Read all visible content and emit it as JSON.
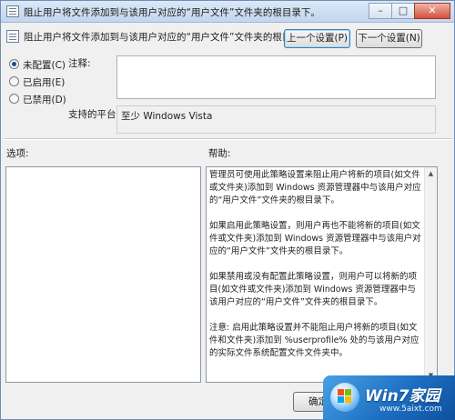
{
  "window": {
    "title": "阻止用户将文件添加到与该用户对应的“用户文件”文件夹的根目录下。"
  },
  "header": {
    "policy_title": "阻止用户将文件添加到与该用户对应的“用户文件”文件夹的根目录下。",
    "prev_button": "上一个设置(P)",
    "next_button": "下一个设置(N)"
  },
  "state": {
    "options": [
      {
        "label": "未配置(C)",
        "checked": true
      },
      {
        "label": "已启用(E)",
        "checked": false
      },
      {
        "label": "已禁用(D)",
        "checked": false
      }
    ]
  },
  "comment": {
    "label": "注释:",
    "value": ""
  },
  "platform": {
    "label": "支持的平台:",
    "value": "至少 Windows Vista"
  },
  "options_section": {
    "label": "选项:"
  },
  "help_section": {
    "label": "帮助:",
    "paragraphs": [
      "管理员可使用此策略设置来阻止用户将新的项目(如文件或文件夹)添加到 Windows 资源管理器中与该用户对应的“用户文件”文件夹的根目录下。",
      "如果启用此策略设置，则用户再也不能将新的项目(如文件或文件夹)添加到 Windows 资源管理器中与该用户对应的“用户文件”文件夹的根目录下。",
      "如果禁用或没有配置此策略设置，则用户可以将新的项目(如文件或文件夹)添加到 Windows 资源管理器中与该用户对应的“用户文件”文件夹的根目录下。",
      "注意: 启用此策略设置并不能阻止用户将新的项目(如文件和文件夹)添加到 %userprofile% 处的与该用户对应的实际文件系统配置文件文件夹中。"
    ]
  },
  "footer": {
    "ok_button": "确定"
  },
  "watermark": {
    "brand": "Win7家园",
    "url": "www.5aixt.com"
  },
  "icons": {
    "window_icon": "policy-document-icon",
    "minimize": "minimize-icon",
    "maximize": "maximize-icon",
    "close": "close-icon"
  }
}
